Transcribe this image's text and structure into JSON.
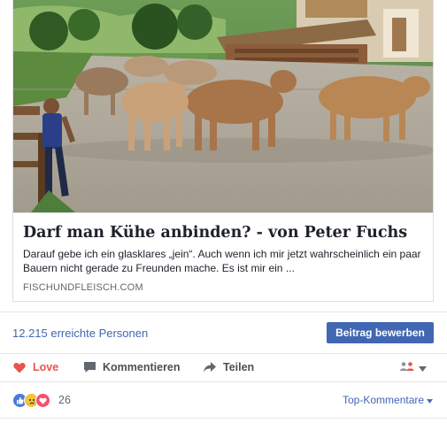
{
  "link_preview": {
    "title": "Darf man Kühe anbinden? - von Peter Fuchs",
    "description": "Darauf gebe ich ein glasklares „jein“. Auch wenn ich mir jetzt wahrscheinlich ein paar Bauern nicht gerade zu Freunden mache. Es ist mir ein ...",
    "domain": "FISCHUNDFLEISCH.COM",
    "image_icon": "cows-on-farm-photo"
  },
  "reach": {
    "text": "12.215 erreichte Personen",
    "promote_label": "Beitrag bewerben"
  },
  "actions": {
    "love_label": "Love",
    "comment_label": "Kommentieren",
    "share_label": "Teilen",
    "love_icon": "heart-icon",
    "comment_icon": "comment-icon",
    "share_icon": "share-icon",
    "audience_icon": "friends-icon"
  },
  "reactions": {
    "count": "26",
    "types": [
      "like",
      "sad",
      "love"
    ],
    "sort_label": "Top-Kommentare"
  },
  "colors": {
    "brand_blue": "#4267b2",
    "love_red": "#e9544b",
    "text_gray": "#4b4f56"
  }
}
